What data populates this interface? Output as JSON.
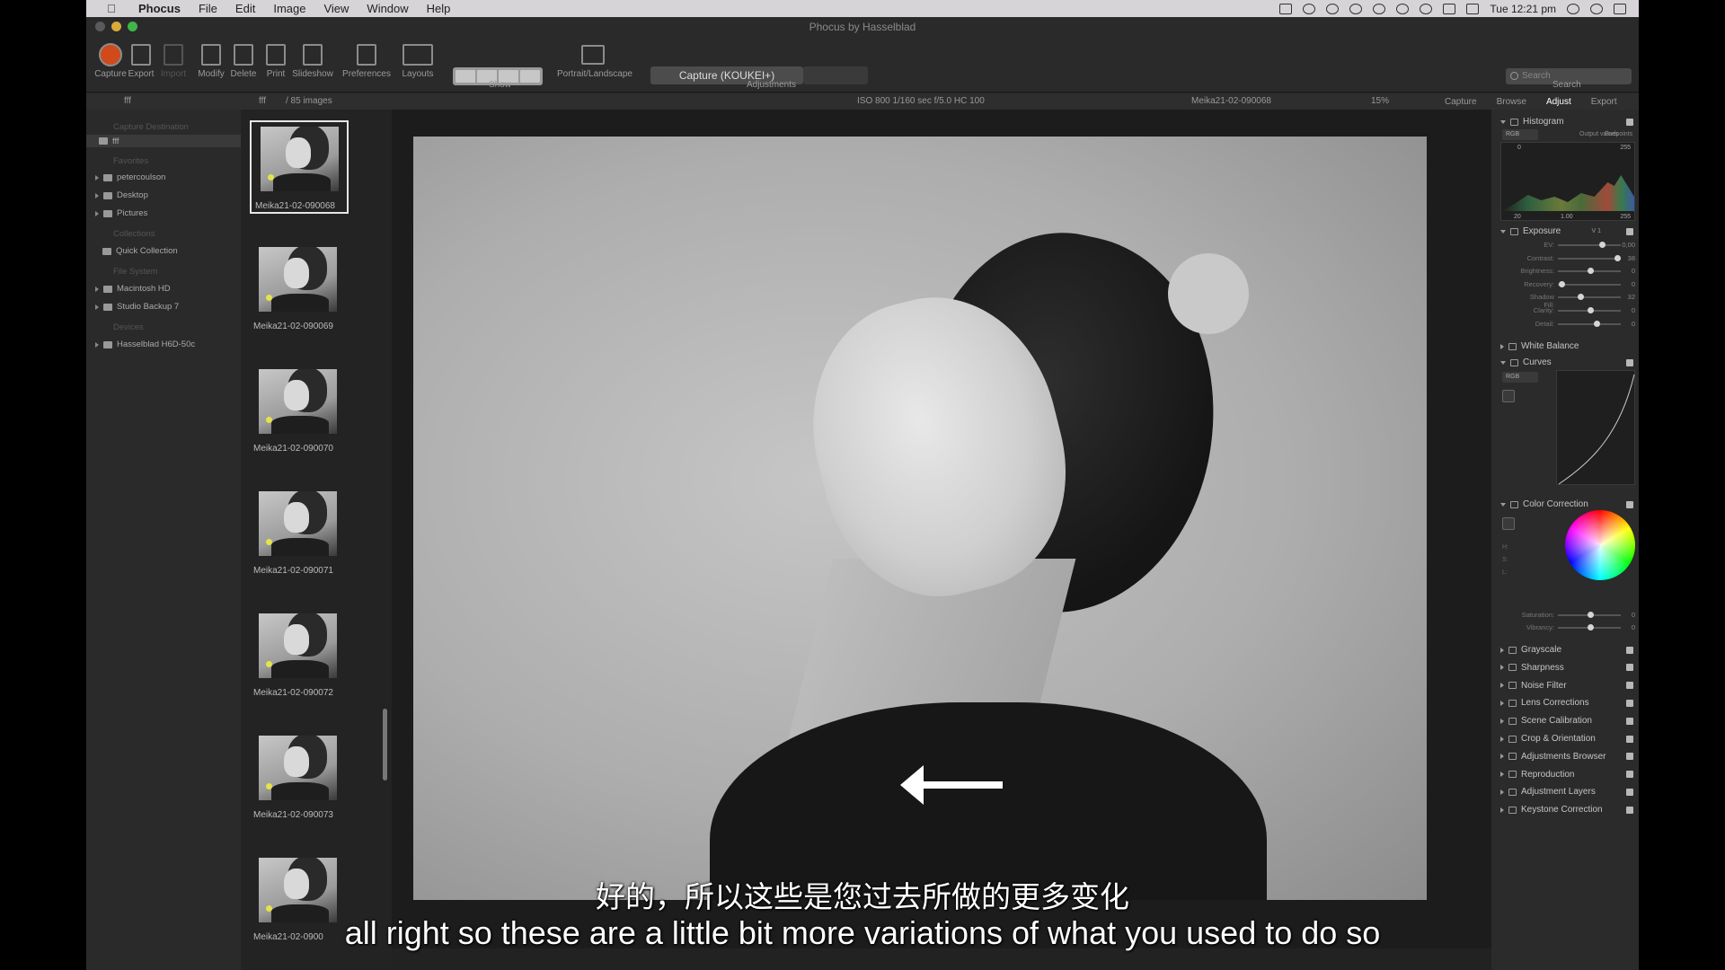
{
  "menubar": {
    "app_name": "Phocus",
    "items": [
      "File",
      "Edit",
      "Image",
      "View",
      "Window",
      "Help"
    ],
    "clock": "Tue 12:21 pm"
  },
  "window": {
    "title": "Phocus by Hasselblad"
  },
  "toolbar": {
    "buttons": [
      {
        "label": "Capture",
        "icon": "record-icon"
      },
      {
        "label": "Export",
        "icon": "export-icon"
      },
      {
        "label": "Import",
        "icon": "import-icon"
      },
      {
        "label": "Modify",
        "icon": "modify-icon"
      },
      {
        "label": "Delete",
        "icon": "delete-icon"
      },
      {
        "label": "Print",
        "icon": "print-icon"
      },
      {
        "label": "Slideshow",
        "icon": "slideshow-icon"
      },
      {
        "label": "Preferences",
        "icon": "preferences-icon"
      },
      {
        "label": "Layouts",
        "icon": "layouts-icon"
      }
    ],
    "show_label": "Show",
    "portrait_label": "Portrait/Landscape",
    "adjustments_label": "Adjustments",
    "capture_preset": "Capture (KOUKEI+)",
    "search_label": "Search",
    "search_placeholder": "Search"
  },
  "infobar": {
    "folder": "fff",
    "image_count": "/ 85 images",
    "exif": "ISO 800  1/160 sec  f/5.0  HC 100",
    "current_file": "Meika21-02-090068",
    "zoom": "15%"
  },
  "tabs": [
    "Capture",
    "Browse",
    "Adjust",
    "Export"
  ],
  "active_tab": "Adjust",
  "sidebar": {
    "path_field": "fff",
    "capture_destination": "Capture Destination",
    "destination_folder": "fff",
    "favorites_head": "Favorites",
    "favorites": [
      "petercoulson",
      "Desktop",
      "Pictures"
    ],
    "collections_head": "Collections",
    "collections": [
      "Quick Collection"
    ],
    "filesystem_head": "File System",
    "filesystem": [
      "Macintosh HD",
      "Studio Backup 7"
    ],
    "devices_head": "Devices",
    "devices": [
      "Hasselblad H6D-50c"
    ]
  },
  "thumbnails": [
    "Meika21-02-090068",
    "Meika21-02-090069",
    "Meika21-02-090070",
    "Meika21-02-090071",
    "Meika21-02-090072",
    "Meika21-02-090073",
    "Meika21-02-0900"
  ],
  "panel": {
    "histogram": {
      "title": "Histogram",
      "channel": "RGB",
      "output_values": "Output values",
      "endpoints": "Endpoints",
      "top_left": "0",
      "top_right": "255",
      "bottom_left": "20",
      "bottom_mid": "1.00",
      "bottom_right": "255"
    },
    "exposure": {
      "title": "Exposure",
      "version": "V 1",
      "sliders": [
        {
          "label": "EV:",
          "value": "0,00",
          "pos": 0.7
        },
        {
          "label": "Contrast:",
          "value": "38",
          "pos": 0.95
        },
        {
          "label": "Brightness:",
          "value": "0",
          "pos": 0.5
        },
        {
          "label": "Recovery:",
          "value": "0",
          "pos": 0.02
        },
        {
          "label": "Shadow Fill:",
          "value": "32",
          "pos": 0.34
        },
        {
          "label": "Clarity:",
          "value": "0",
          "pos": 0.5
        },
        {
          "label": "Detail:",
          "value": "0",
          "pos": 0.6
        }
      ]
    },
    "white_balance": "White Balance",
    "curves": {
      "title": "Curves",
      "channel": "RGB"
    },
    "color_correction": {
      "title": "Color Correction",
      "h_label": "H:",
      "s_label": "S:",
      "l_label": "L:",
      "saturation": {
        "label": "Saturation:",
        "value": "0",
        "pos": 0.5
      },
      "vibrancy": {
        "label": "Vibrancy:",
        "value": "0",
        "pos": 0.5
      }
    },
    "sections": [
      "Grayscale",
      "Sharpness",
      "Noise Filter",
      "Lens Corrections",
      "Scene Calibration",
      "Crop & Orientation",
      "Adjustments Browser",
      "Reproduction",
      "Adjustment Layers",
      "Keystone Correction"
    ]
  },
  "subtitles": {
    "chinese": "好的，所以这些是您过去所做的更多变化",
    "english": "all right so these are a little bit more variations of what you used to do so"
  },
  "colors": {
    "accent_record": "#d04a1c",
    "rating_dot": "#e3e34a"
  }
}
